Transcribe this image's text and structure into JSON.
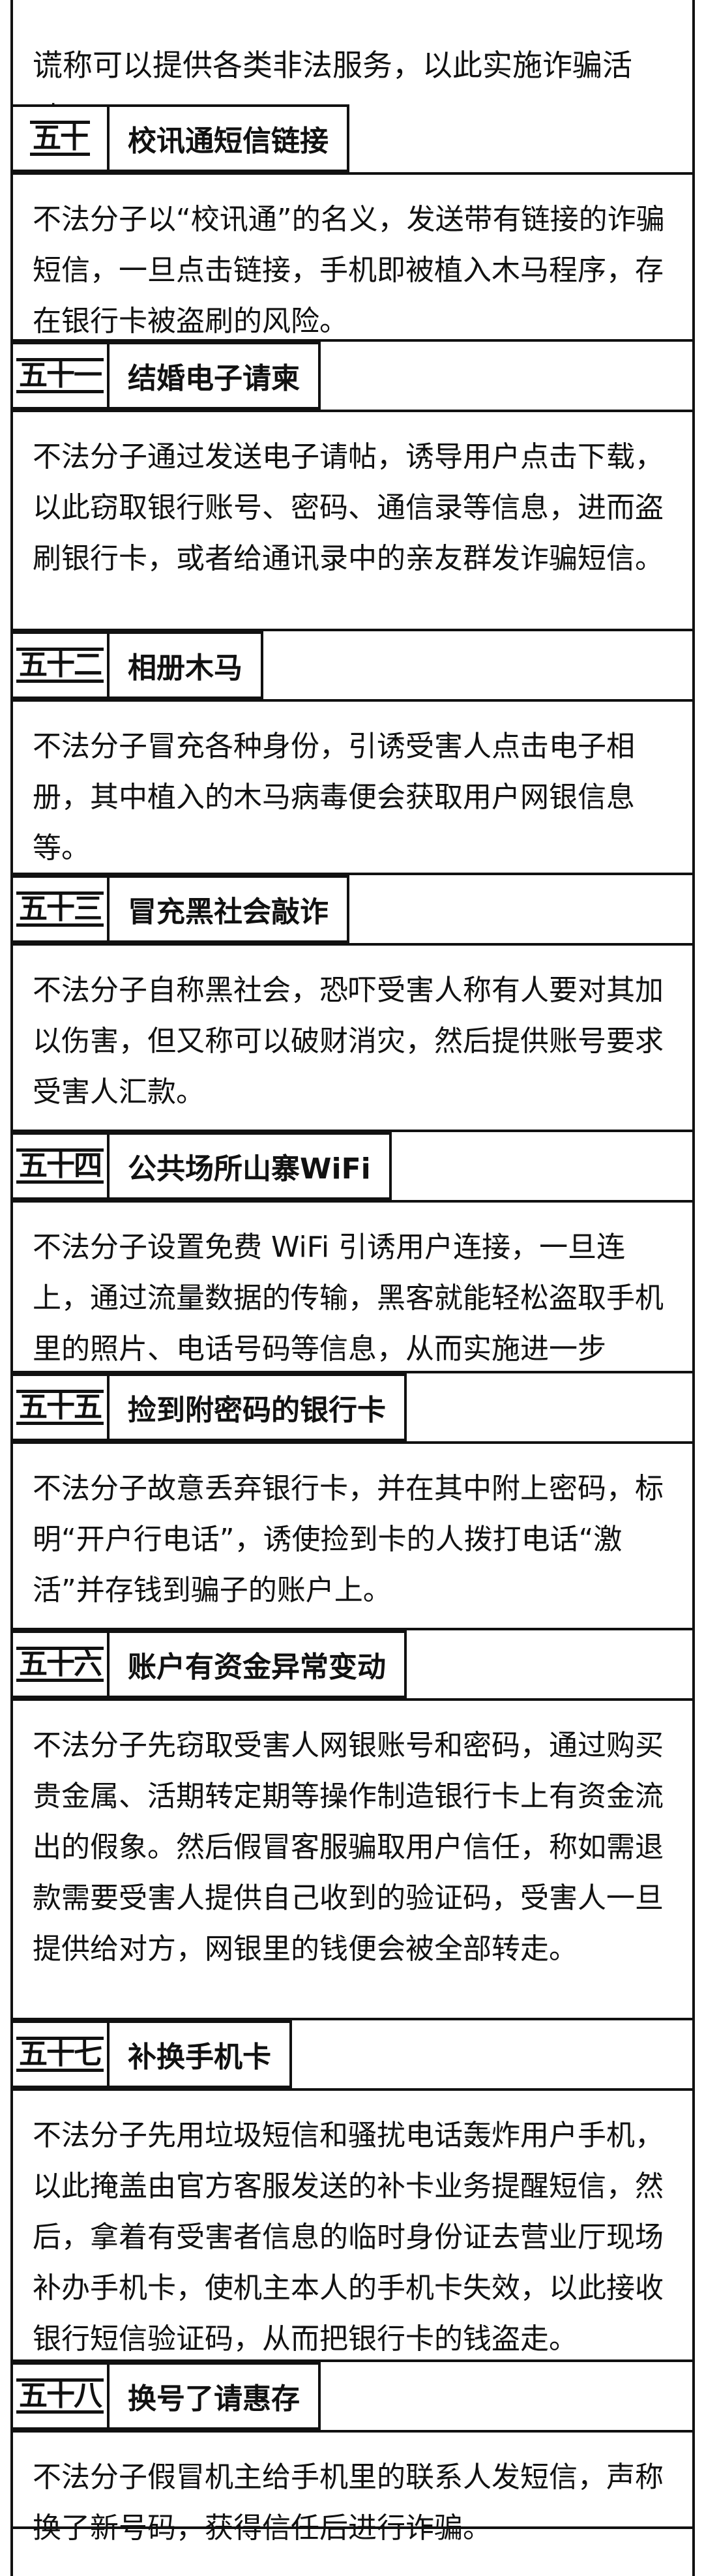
{
  "intro": "谎称可以提供各类非法服务，以此实施诈骗活动。",
  "sections": [
    {
      "num": "五十",
      "title": "校讯通短信链接",
      "text": "不法分子以“校讯通”的名义，发送带有链接的诈骗短信，一旦点击链接，手机即被植入木马程序，存在银行卡被盗刷的风险。"
    },
    {
      "num": "五十一",
      "title": "结婚电子请柬",
      "text": "不法分子通过发送电子请帖，诱导用户点击下载，以此窃取银行账号、密码、通信录等信息，进而盗刷银行卡，或者给通讯录中的亲友群发诈骗短信。"
    },
    {
      "num": "五十二",
      "title": "相册木马",
      "text": "不法分子冒充各种身份，引诱受害人点击电子相册，其中植入的木马病毒便会获取用户网银信息等。"
    },
    {
      "num": "五十三",
      "title": "冒充黑社会敲诈",
      "text": "不法分子自称黑社会，恐吓受害人称有人要对其加以伤害，但又称可以破财消灾，然后提供账号要求受害人汇款。"
    },
    {
      "num": "五十四",
      "title": "公共场所山寨WiFi",
      "text": "不法分子设置免费 WiFi 引诱用户连接，一旦连上，通过流量数据的传输，黑客就能轻松盗取手机里的照片、电话号码等信息，从而实施进一步"
    },
    {
      "num": "五十五",
      "title": "捡到附密码的银行卡",
      "text": "不法分子故意丢弃银行卡，并在其中附上密码，标明“开户行电话”，诱使捡到卡的人拨打电话“激活”并存钱到骗子的账户上。"
    },
    {
      "num": "五十六",
      "title": "账户有资金异常变动",
      "text": "不法分子先窃取受害人网银账号和密码，通过购买贵金属、活期转定期等操作制造银行卡上有资金流出的假象。然后假冒客服骗取用户信任，称如需退款需要受害人提供自己收到的验证码，受害人一旦提供给对方，网银里的钱便会被全部转走。"
    },
    {
      "num": "五十七",
      "title": "补换手机卡",
      "text": "不法分子先用垃圾短信和骚扰电话轰炸用户手机，以此掩盖由官方客服发送的补卡业务提醒短信，然后，拿着有受害者信息的临时身份证去营业厅现场补办手机卡，使机主本人的手机卡失效，以此接收银行短信验证码，从而把银行卡的钱盗走。"
    },
    {
      "num": "五十八",
      "title": "换号了请惠存",
      "text": "不法分子假冒机主给手机里的联系人发短信，声称换了新号码，获得信任后进行诈骗。"
    }
  ]
}
